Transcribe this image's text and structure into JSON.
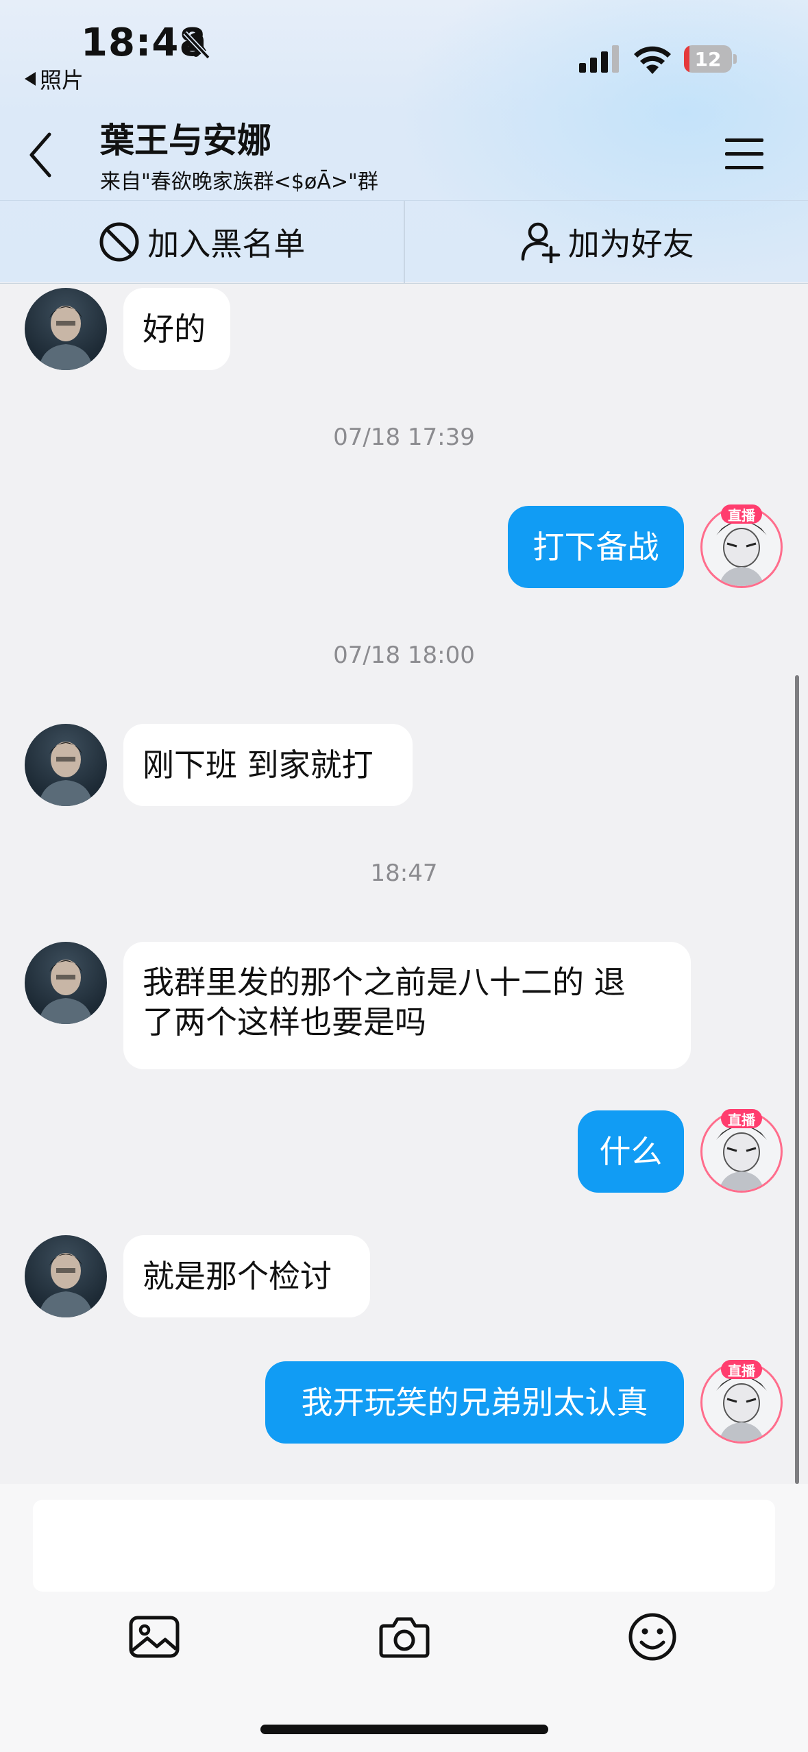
{
  "status_bar": {
    "time": "18:48",
    "back_app": "照片",
    "battery": "12",
    "battery_level": 0.12
  },
  "header": {
    "title": "葉王与安娜",
    "subtitle": "来自\"春欲晚家族群<$øĀ>\"群"
  },
  "actions": {
    "blacklist": "加入黑名单",
    "add_friend": "加为好友"
  },
  "messages": [
    {
      "side": "left",
      "text": "好的"
    },
    {
      "timestamp": "07/18 17:39"
    },
    {
      "side": "right",
      "text": "打下备战"
    },
    {
      "timestamp": "07/18 18:00"
    },
    {
      "side": "left",
      "text": "刚下班 到家就打"
    },
    {
      "timestamp": "18:47"
    },
    {
      "side": "left",
      "text_line1": "我群里发的那个之前是八十二的 退",
      "text_line2": "了两个这样也要是吗"
    },
    {
      "side": "right",
      "text": "什么"
    },
    {
      "side": "left",
      "text": "就是那个检讨"
    },
    {
      "side": "right",
      "text": "我开玩笑的兄弟别太认真"
    }
  ],
  "live_badge": "直播",
  "colors": {
    "accent_blue": "#119cf4",
    "live_pink": "#ff3d6e",
    "battery_red": "#e5393b"
  },
  "icons": [
    "bell-off-icon",
    "signal-icon",
    "wifi-icon",
    "battery-icon",
    "back-chevron-icon",
    "menu-icon",
    "block-icon",
    "add-user-icon",
    "image-icon",
    "camera-icon",
    "emoji-icon"
  ]
}
